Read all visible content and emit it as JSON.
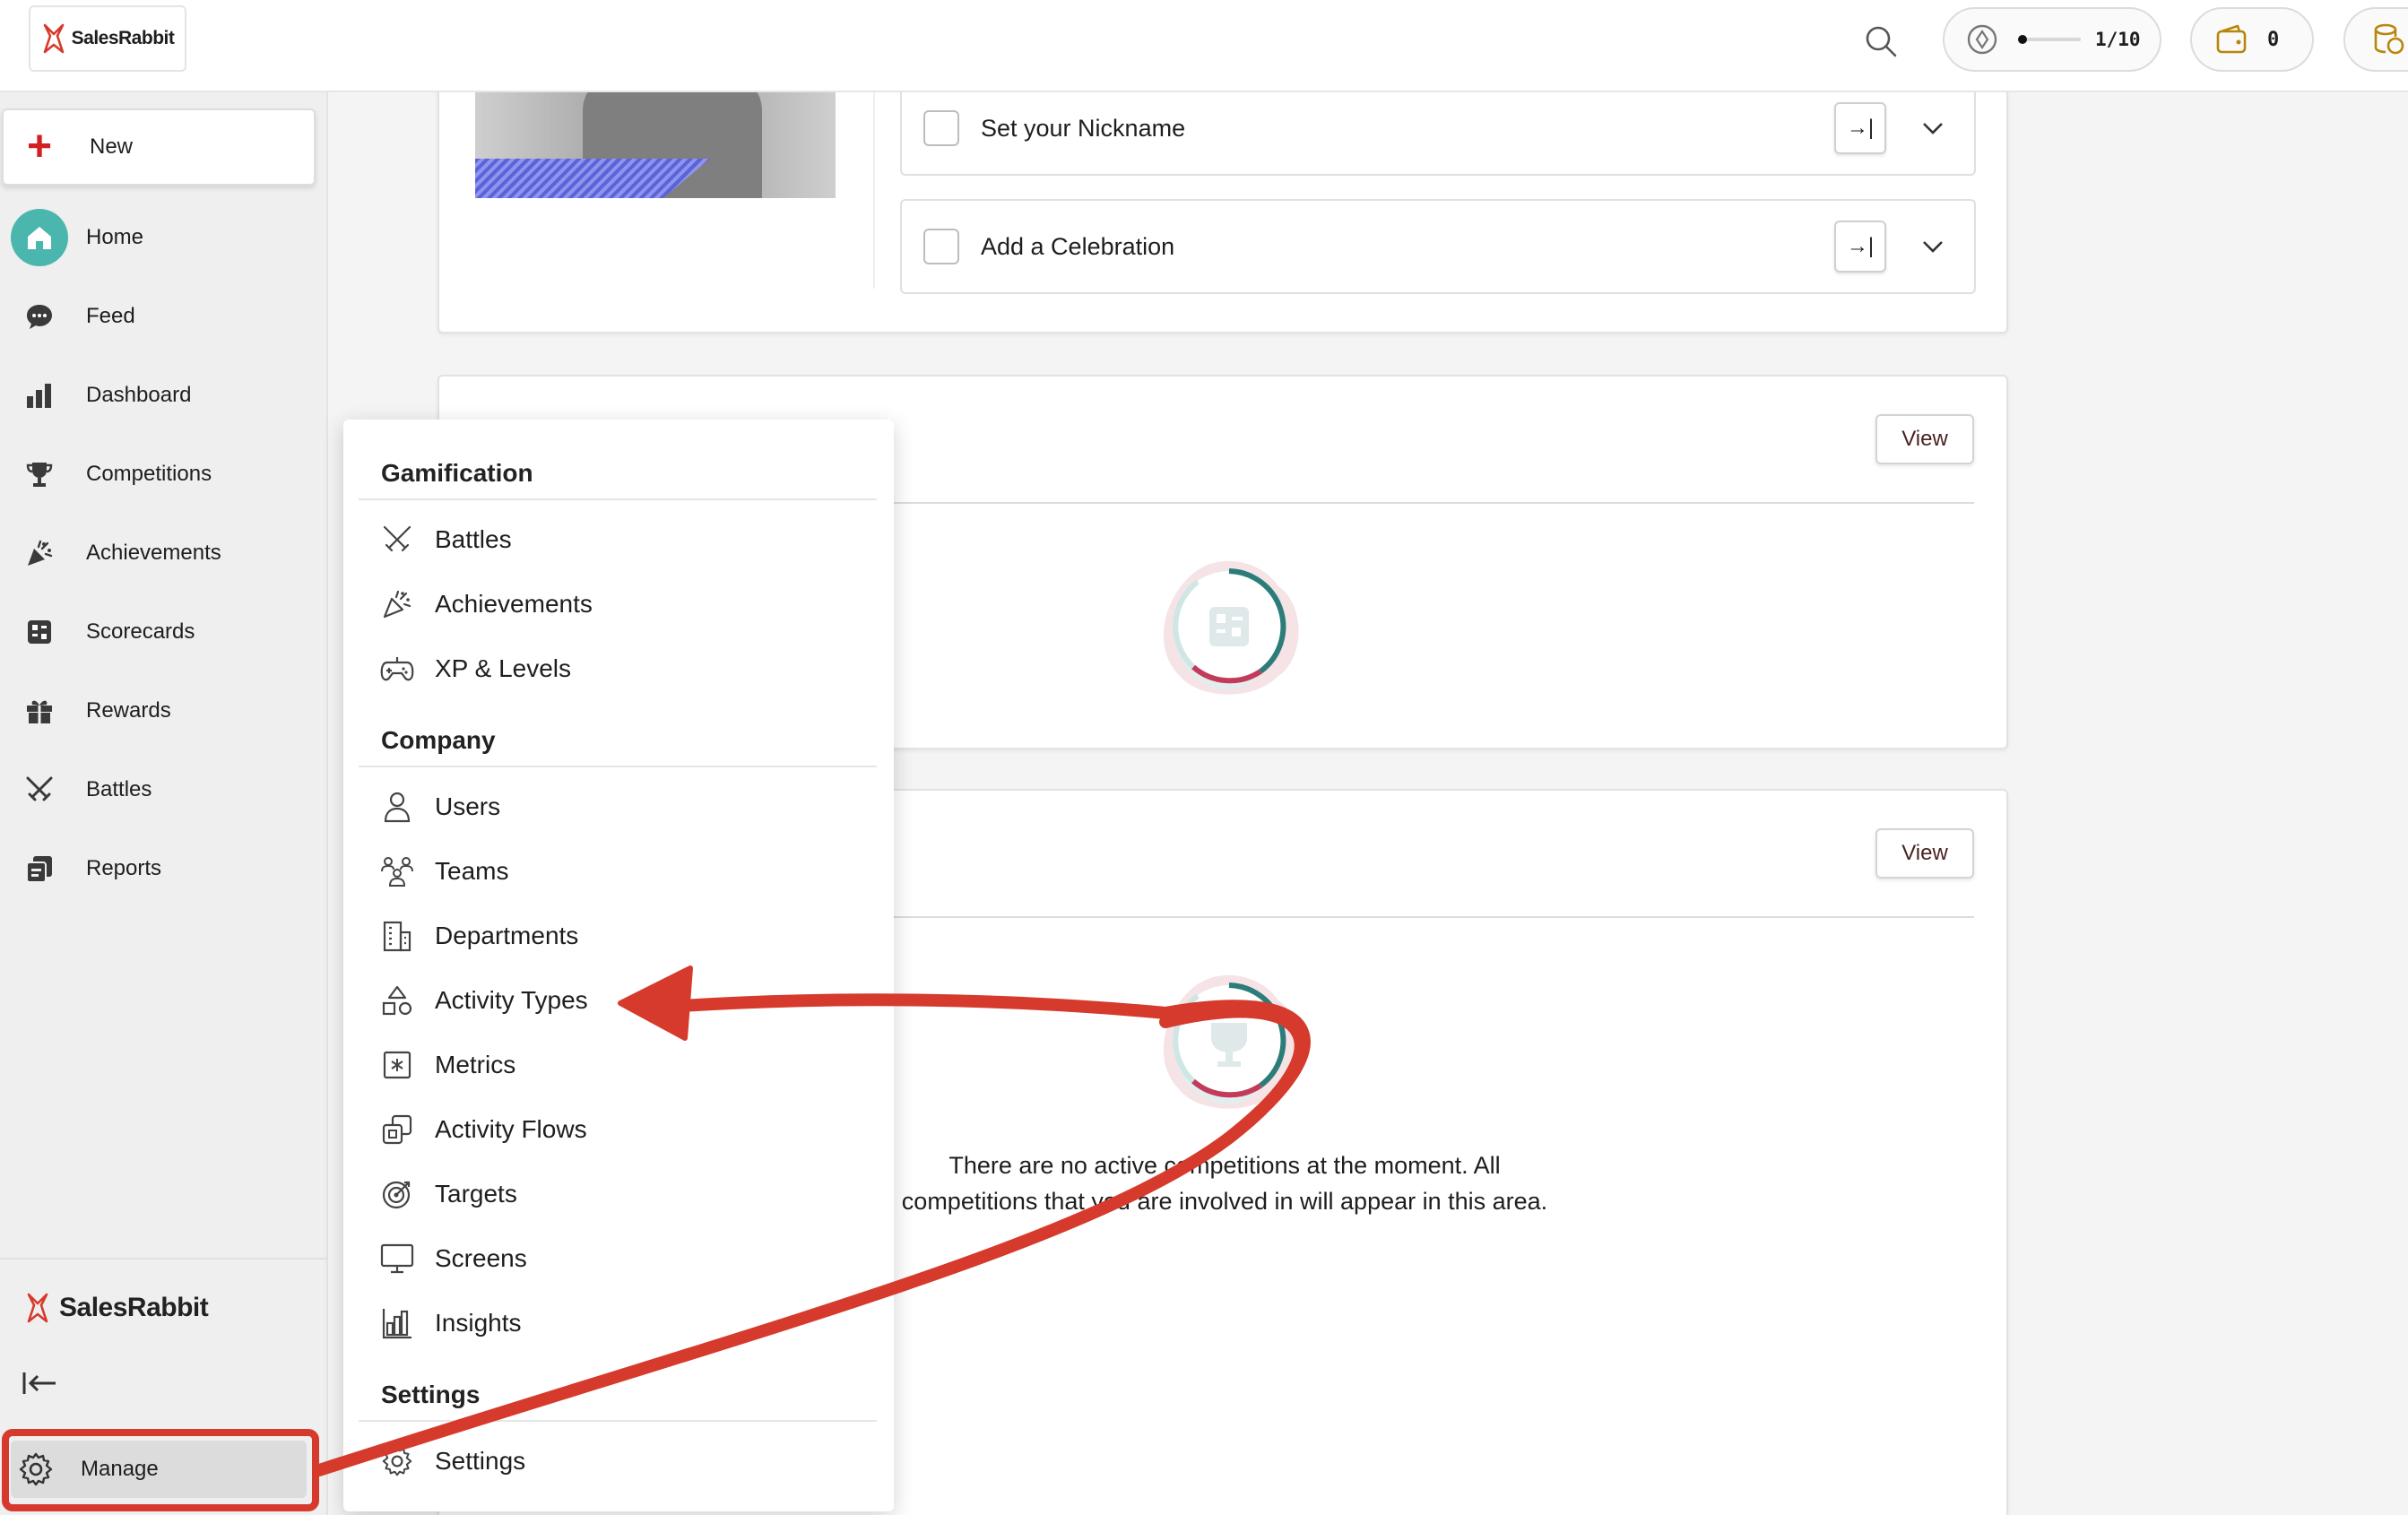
{
  "app": {
    "brand": "SalesRabbit",
    "accent": "#d63a2c",
    "home_color": "#4bb6ad"
  },
  "topbar": {
    "xp_count": "1/10",
    "wallet_count": "0"
  },
  "sidebar": {
    "new_label": "New",
    "items": [
      {
        "label": "Home",
        "icon": "home-icon"
      },
      {
        "label": "Feed",
        "icon": "chat-bubble-icon"
      },
      {
        "label": "Dashboard",
        "icon": "bar-chart-icon"
      },
      {
        "label": "Competitions",
        "icon": "trophy-icon"
      },
      {
        "label": "Achievements",
        "icon": "party-popper-icon"
      },
      {
        "label": "Scorecards",
        "icon": "scorecard-icon"
      },
      {
        "label": "Rewards",
        "icon": "gift-icon"
      },
      {
        "label": "Battles",
        "icon": "crossed-swords-icon"
      },
      {
        "label": "Reports",
        "icon": "reports-icon"
      }
    ],
    "brand": "SalesRabbit",
    "manage_label": "Manage"
  },
  "tasks": [
    {
      "label": "Set your Nickname"
    },
    {
      "label": "Add a Celebration"
    }
  ],
  "cards": {
    "view_label": "View"
  },
  "competitions": {
    "empty_line1": "There are no active competitions at the moment. All",
    "empty_line2": "competitions that you are involved in will appear in this area."
  },
  "menu": {
    "sections": [
      {
        "title": "Gamification",
        "items": [
          "Battles",
          "Achievements",
          "XP & Levels"
        ]
      },
      {
        "title": "Company",
        "items": [
          "Users",
          "Teams",
          "Departments",
          "Activity Types",
          "Metrics",
          "Activity Flows",
          "Targets",
          "Screens",
          "Insights"
        ]
      },
      {
        "title": "Settings",
        "items": [
          "Settings"
        ]
      }
    ]
  }
}
